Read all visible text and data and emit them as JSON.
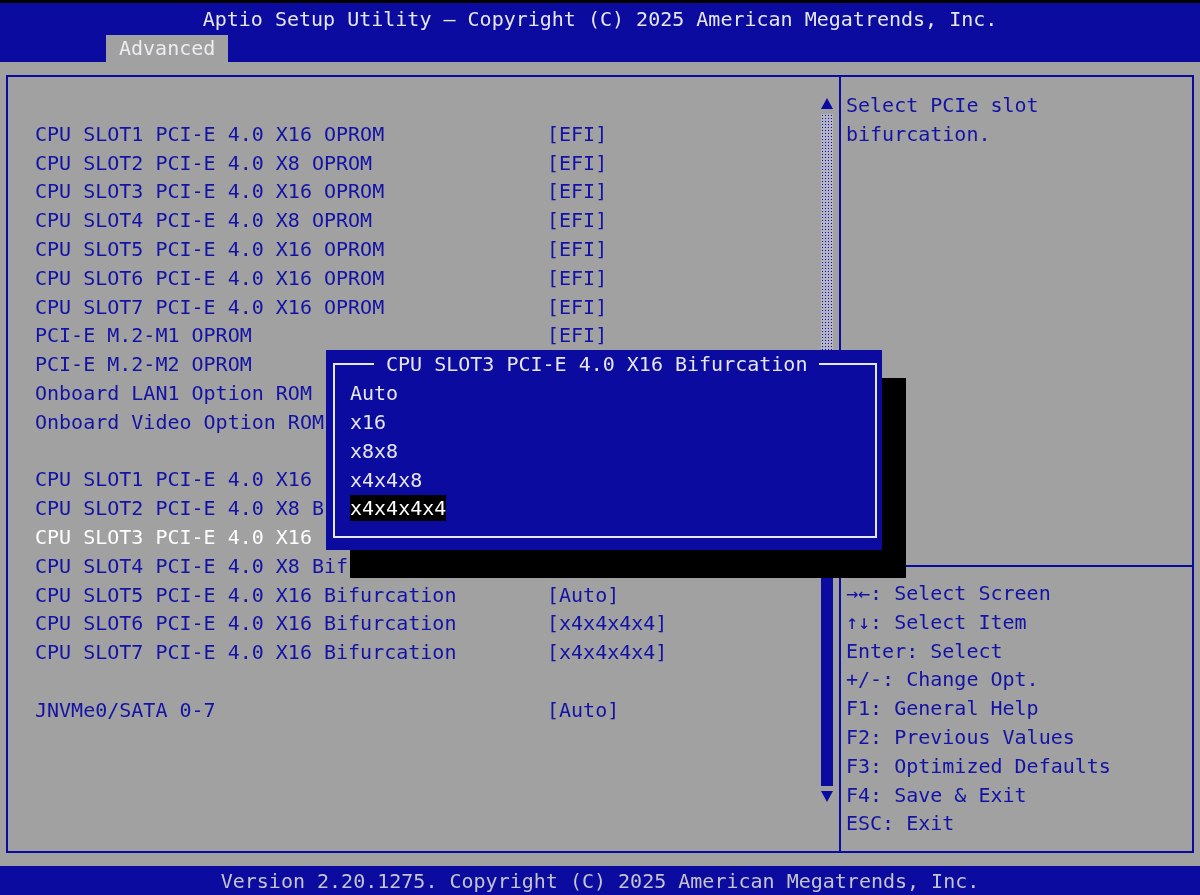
{
  "window": {
    "title": "Aptio Setup Utility – Copyright (C) 2025 American Megatrends, Inc."
  },
  "tabs": [
    {
      "label": "Advanced",
      "selected": true
    }
  ],
  "settings": {
    "groups": [
      {
        "items": [
          {
            "label": "CPU SLOT1 PCI-E 4.0 X16 OPROM",
            "value": "[EFI]",
            "selected": false
          },
          {
            "label": "CPU SLOT2 PCI-E 4.0 X8 OPROM",
            "value": "[EFI]",
            "selected": false
          },
          {
            "label": "CPU SLOT3 PCI-E 4.0 X16 OPROM",
            "value": "[EFI]",
            "selected": false
          },
          {
            "label": "CPU SLOT4 PCI-E 4.0 X8 OPROM",
            "value": "[EFI]",
            "selected": false
          },
          {
            "label": "CPU SLOT5 PCI-E 4.0 X16 OPROM",
            "value": "[EFI]",
            "selected": false
          },
          {
            "label": "CPU SLOT6 PCI-E 4.0 X16 OPROM",
            "value": "[EFI]",
            "selected": false
          },
          {
            "label": "CPU SLOT7 PCI-E 4.0 X16 OPROM",
            "value": "[EFI]",
            "selected": false
          },
          {
            "label": "PCI-E M.2-M1 OPROM",
            "value": "[EFI]",
            "selected": false
          },
          {
            "label": "PCI-E M.2-M2 OPROM",
            "selected": false
          },
          {
            "label": "Onboard LAN1 Option ROM",
            "selected": false
          },
          {
            "label": "Onboard Video Option ROM",
            "selected": false
          }
        ]
      },
      {
        "items": [
          {
            "label": "CPU SLOT1 PCI-E 4.0 X16",
            "selected": false
          },
          {
            "label": "CPU SLOT2 PCI-E 4.0 X8 B",
            "selected": false
          },
          {
            "label": "CPU SLOT3 PCI-E 4.0 X16",
            "selected": true
          },
          {
            "label": "CPU SLOT4 PCI-E 4.0 X8 Bif",
            "selected": false
          },
          {
            "label": "CPU SLOT5 PCI-E 4.0 X16 Bifurcation",
            "value": "[Auto]",
            "selected": false
          },
          {
            "label": "CPU SLOT6 PCI-E 4.0 X16 Bifurcation",
            "value": "[x4x4x4x4]",
            "selected": false
          },
          {
            "label": "CPU SLOT7 PCI-E 4.0 X16 Bifurcation",
            "value": "[x4x4x4x4]",
            "selected": false
          }
        ]
      },
      {
        "items": [
          {
            "label": "JNVMe0/SATA 0-7",
            "value": "[Auto]",
            "selected": false
          }
        ]
      }
    ]
  },
  "help": {
    "text": "Select PCIe slot bifurcation."
  },
  "key_legend": [
    "→←: Select Screen",
    "↑↓: Select Item",
    "Enter: Select",
    "+/-: Change Opt.",
    "F1: General Help",
    "F2: Previous Values",
    "F3: Optimized Defaults",
    "F4: Save & Exit",
    "ESC: Exit"
  ],
  "popup": {
    "title": "CPU SLOT3 PCI-E 4.0 X16 Bifurcation",
    "options": [
      {
        "label": "Auto",
        "selected": false
      },
      {
        "label": "x16",
        "selected": false
      },
      {
        "label": "x8x8",
        "selected": false
      },
      {
        "label": "x4x4x8",
        "selected": false
      },
      {
        "label": "x4x4x4x4",
        "selected": true
      }
    ]
  },
  "status_bar": {
    "text": "Version 2.20.1275. Copyright (C) 2025 American Megatrends, Inc."
  }
}
